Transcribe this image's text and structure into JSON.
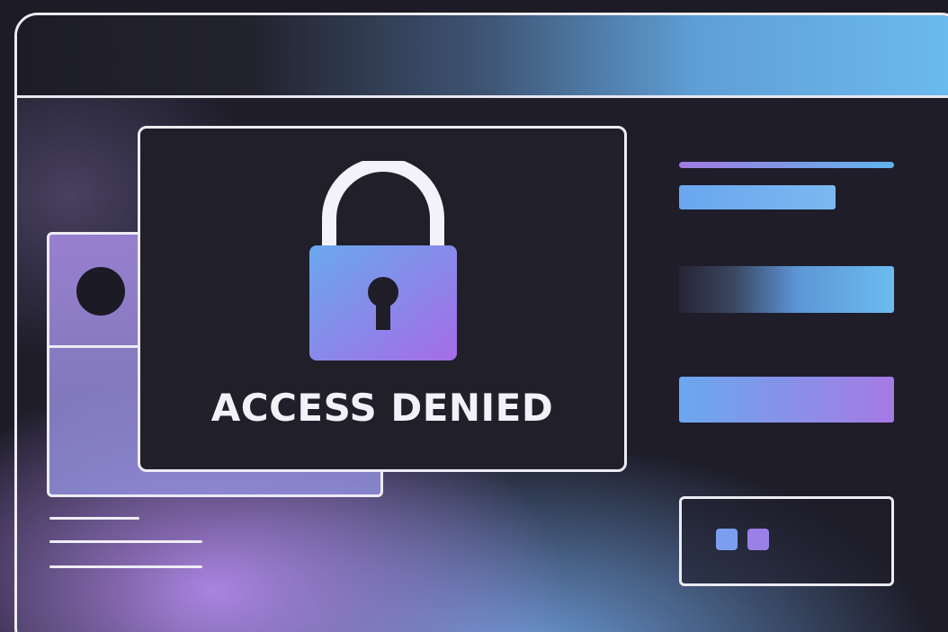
{
  "dialog": {
    "title": "ACCESS DENIED",
    "icon": "lock-icon"
  },
  "colors": {
    "background": "#1e1d29",
    "border": "#ecebf2",
    "accent_blue": "#6cbbef",
    "accent_purple": "#a77ee8",
    "lock_gradient_start": "#6ba6ec",
    "lock_gradient_end": "#a46fe6"
  },
  "sidebar": {
    "placeholders": [
      "divider-line",
      "short-bar",
      "gradient-bar",
      "gradient-bar"
    ],
    "card": {
      "icons": [
        "square-icon",
        "square-icon"
      ]
    }
  },
  "background_panel": {
    "icon": "avatar-circle"
  }
}
